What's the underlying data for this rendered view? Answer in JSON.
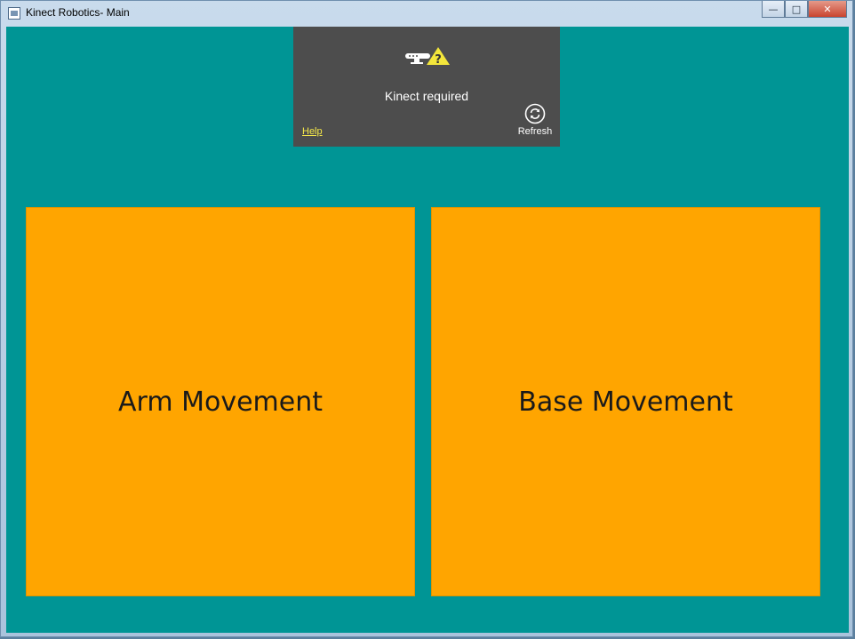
{
  "window": {
    "title": "Kinect Robotics- Main",
    "minimize_glyph": "—",
    "maximize_glyph": "□",
    "close_glyph": "✕"
  },
  "kinect_status": {
    "message": "Kinect required",
    "help_label": "Help",
    "refresh_label": "Refresh",
    "icon": "kinect-warning-icon"
  },
  "tiles": {
    "arm": "Arm Movement",
    "base": "Base Movement"
  },
  "colors": {
    "client_background": "#009595",
    "tile": "#ffa500",
    "status_panel": "#4d4d4d",
    "help_link": "#f6e94a"
  }
}
